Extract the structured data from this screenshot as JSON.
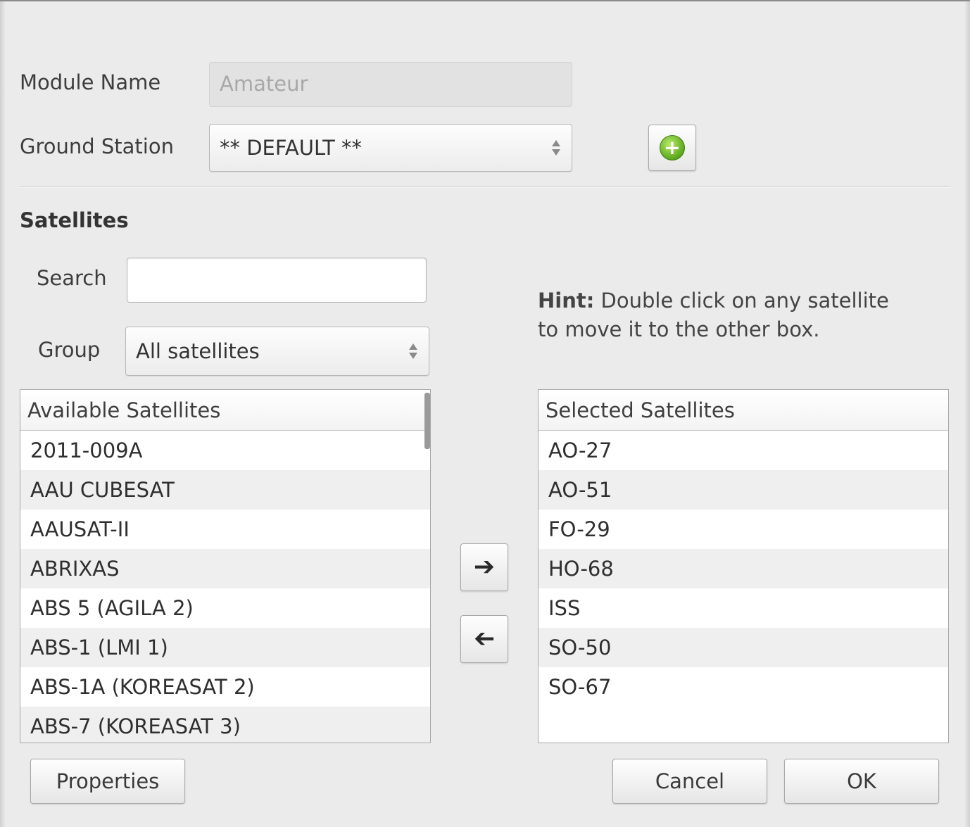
{
  "form": {
    "module_name_label": "Module Name",
    "module_name_value": "Amateur",
    "ground_station_label": "Ground Station",
    "ground_station_value": "** DEFAULT **",
    "add_icon": "plus-circle-icon"
  },
  "satellites": {
    "heading": "Satellites",
    "search_label": "Search",
    "search_value": "",
    "group_label": "Group",
    "group_value": "All satellites",
    "hint_bold": "Hint:",
    "hint_line1": "Double click on any satellite",
    "hint_line2": "to move it to the other box.",
    "available_header": "Available Satellites",
    "available": [
      "2011-009A",
      "AAU CUBESAT",
      "AAUSAT-II",
      "ABRIXAS",
      "ABS 5 (AGILA 2)",
      "ABS-1 (LMI 1)",
      "ABS-1A (KOREASAT 2)",
      "ABS-7 (KOREASAT 3)"
    ],
    "selected_header": "Selected Satellites",
    "selected": [
      "AO-27",
      "AO-51",
      "FO-29",
      "HO-68",
      "ISS",
      "SO-50",
      "SO-67"
    ],
    "move_right_icon": "arrow-right-icon",
    "move_left_icon": "arrow-left-icon"
  },
  "buttons": {
    "properties": "Properties",
    "cancel": "Cancel",
    "ok": "OK"
  }
}
